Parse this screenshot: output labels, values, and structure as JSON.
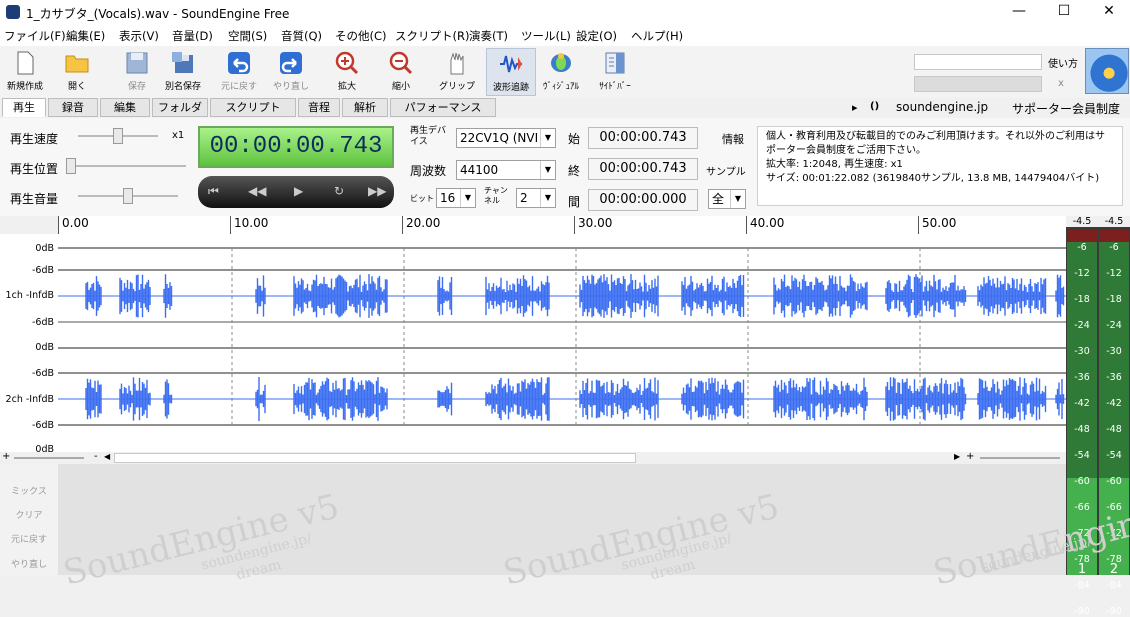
{
  "window": {
    "title": "1_カサブタ_(Vocals).wav - SoundEngine Free"
  },
  "menu": [
    "ファイル(F)",
    "編集(E)",
    "表示(V)",
    "音量(D)",
    "空間(S)",
    "音質(Q)",
    "その他(C)",
    "スクリプト(R)",
    "演奏(T)",
    "ツール(L)",
    "設定(O)",
    "ヘルプ(H)"
  ],
  "toolbar": [
    {
      "label": "新規作成",
      "icon": "new-file-icon",
      "enabled": true
    },
    {
      "label": "開く",
      "icon": "folder-open-icon",
      "enabled": true
    },
    {
      "label": "保存",
      "icon": "save-icon",
      "enabled": false
    },
    {
      "label": "別名保存",
      "icon": "save-as-icon",
      "enabled": true
    },
    {
      "label": "元に戻す",
      "icon": "undo-icon",
      "enabled": false
    },
    {
      "label": "やり直し",
      "icon": "redo-icon",
      "enabled": false
    },
    {
      "label": "拡大",
      "icon": "zoom-in-icon",
      "enabled": true
    },
    {
      "label": "縮小",
      "icon": "zoom-out-icon",
      "enabled": true
    },
    {
      "label": "グリップ",
      "icon": "grip-hand-icon",
      "enabled": true
    },
    {
      "label": "波形追跡",
      "icon": "waveform-follow-icon",
      "enabled": true
    },
    {
      "label": "ｳﾞｨｼﾞｭｱﾙ",
      "icon": "visual-icon",
      "enabled": true
    },
    {
      "label": "ｻｲﾄﾞﾊﾞｰ",
      "icon": "sidebar-icon",
      "enabled": true
    }
  ],
  "help_link": "使い方",
  "close_x": "x",
  "tabs": [
    "再生",
    "録音",
    "編集",
    "フォルダ",
    "スクリプト",
    "音程",
    "解析",
    "パフォーマンス"
  ],
  "site": {
    "arrow": "▸",
    "icon": "()",
    "link": "soundengine.jp",
    "supporter": "サポーター会員制度"
  },
  "playback": {
    "speed_label": "再生速度",
    "speed_value": "x1",
    "position_label": "再生位置",
    "volume_label": "再生音量",
    "time": "00:00:00.743",
    "speed_level": 0.5,
    "position_level": 0.0,
    "volume_level": 0.5
  },
  "transport": [
    "⏮",
    "◀◀",
    "▶",
    "↻",
    "▶▶"
  ],
  "device": {
    "label": "再生デバイス",
    "value": "22CV1Q (NVI"
  },
  "freq": {
    "label": "周波数",
    "value": "44100"
  },
  "bits": {
    "label": "ビット",
    "value": "16",
    "ch_label": "チャンネル",
    "ch_value": "2"
  },
  "range": {
    "start_label": "始",
    "start": "00:00:00.743",
    "end_label": "終",
    "end": "00:00:00.743",
    "span_label": "間",
    "span": "00:00:00.000",
    "info_label": "情報",
    "sample_label": "サンプル",
    "all_value": "全"
  },
  "info_text": "個人・教育利用及び転載目的でのみご利用頂けます。それ以外のご利用はサポーター会員制度をご活用下さい。\n拡大率: 1:2048, 再生速度: x1\nサイズ: 00:01:22.082 (3619840サンプル, 13.8 MB, 14479404バイト)",
  "ruler": [
    "0.00",
    "10.00",
    "20.00",
    "30.00",
    "40.00",
    "50.00"
  ],
  "y_labels": [
    "0dB",
    "-6dB",
    "1ch -InfdB",
    "-6dB",
    "0dB",
    "-6dB",
    "2ch -InfdB",
    "-6dB",
    "0dB"
  ],
  "meter": {
    "top": [
      "-4.5",
      "-4.5"
    ],
    "ticks": [
      "-6",
      "-12",
      "-18",
      "-24",
      "-30",
      "-36",
      "-42",
      "-48",
      "-54",
      "-60",
      "-66",
      "-72",
      "-78",
      "-84",
      "-90"
    ],
    "channels": [
      "1",
      "2"
    ]
  },
  "bottom_side": [
    "ミックス",
    "クリア",
    "元に戻す",
    "やり直し"
  ],
  "watermark": {
    "logo": "SoundEngine v5",
    "url": "soundengine.jp/",
    "dream": "dream"
  },
  "scroll": {
    "plus": "+",
    "minus": "-"
  },
  "colors": {
    "wave": "#3b6ef0",
    "timebox": "#6fd84a"
  }
}
